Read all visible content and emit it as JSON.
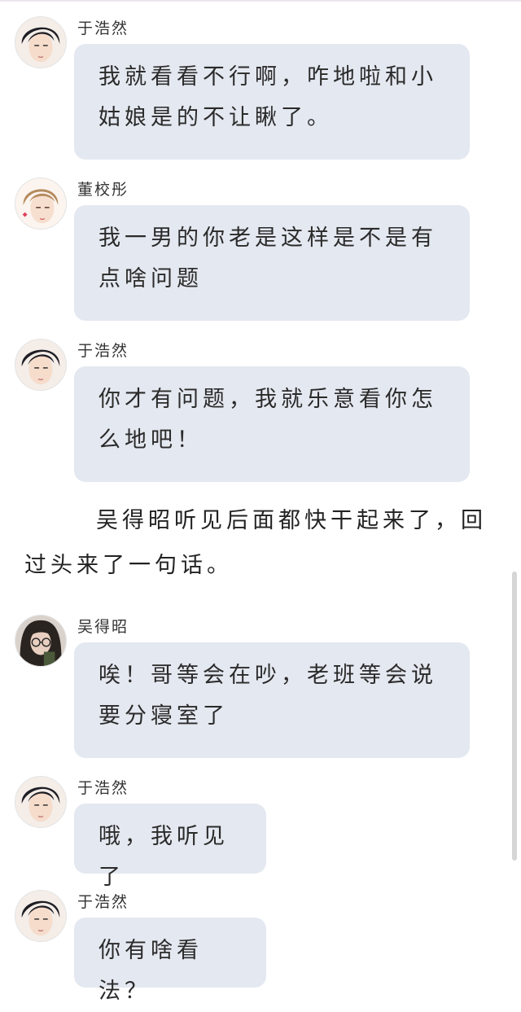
{
  "speakers": {
    "yu": "于浩然",
    "dong": "董校彤",
    "wu": "吴得昭"
  },
  "messages": [
    {
      "speaker": "于浩然",
      "text": "我就看看不行啊，咋地啦和小姑娘是的不让瞅了。"
    },
    {
      "speaker": "董校彤",
      "text": "我一男的你老是这样是不是有点啥问题"
    },
    {
      "speaker": "于浩然",
      "text": "你才有问题，我就乐意看你怎么地吧！"
    },
    {
      "speaker": "吴得昭",
      "text": "唉！哥等会在吵，老班等会说要分寝室了"
    },
    {
      "speaker": "于浩然",
      "text": "哦，我听见了"
    },
    {
      "speaker": "于浩然",
      "text": "你有啥看法？"
    }
  ],
  "narration": "吴得昭听见后面都快干起来了，回过头来了一句话。",
  "colors": {
    "bubble": "#e4e8f0",
    "text": "#2a2a2a",
    "background": "#ffffff"
  },
  "avatars": {
    "yu": "dark-haired-boy-avatar-icon",
    "dong": "light-haired-boy-avatar-icon",
    "wu": "glasses-girl-avatar-icon"
  }
}
